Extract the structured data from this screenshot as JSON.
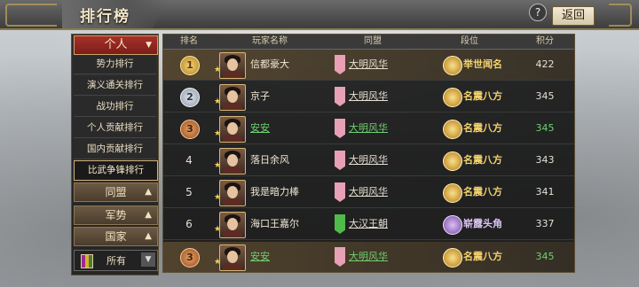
{
  "header": {
    "title": "排行榜",
    "help_icon": "?",
    "back_label": "返回"
  },
  "side": {
    "header": "个人",
    "items": [
      {
        "label": "势力排行",
        "active": false
      },
      {
        "label": "演义通关排行",
        "active": false
      },
      {
        "label": "战功排行",
        "active": false
      },
      {
        "label": "个人贡献排行",
        "active": false
      },
      {
        "label": "国内贡献排行",
        "active": false
      },
      {
        "label": "比武争锋排行",
        "active": true
      }
    ],
    "categories": [
      "同盟",
      "军势",
      "国家"
    ],
    "filter_value": "所有"
  },
  "table": {
    "columns": [
      "排名",
      "玩家名称",
      "同盟",
      "段位",
      "积分"
    ],
    "rows": [
      {
        "rank": "1",
        "medal": "gold",
        "name": "信都豪大",
        "alliance": "大明风华",
        "tier": "举世闻名",
        "score": "422",
        "highlight": true,
        "self": false,
        "tier_style": "gold",
        "banner": "pink"
      },
      {
        "rank": "2",
        "medal": "silver",
        "name": "京子",
        "alliance": "大明风华",
        "tier": "名震八方",
        "score": "345",
        "highlight": false,
        "self": false,
        "tier_style": "gold",
        "banner": "pink"
      },
      {
        "rank": "3",
        "medal": "bronze",
        "name": "安安",
        "alliance": "大明风华",
        "tier": "名震八方",
        "score": "345",
        "highlight": false,
        "self": true,
        "tier_style": "gold",
        "banner": "pink"
      },
      {
        "rank": "4",
        "medal": "",
        "name": "落日余风",
        "alliance": "大明风华",
        "tier": "名震八方",
        "score": "343",
        "highlight": false,
        "self": false,
        "tier_style": "gold",
        "banner": "pink"
      },
      {
        "rank": "5",
        "medal": "",
        "name": "我是暗力棒",
        "alliance": "大明风华",
        "tier": "名震八方",
        "score": "341",
        "highlight": false,
        "self": false,
        "tier_style": "gold",
        "banner": "pink"
      },
      {
        "rank": "6",
        "medal": "",
        "name": "海口王嘉尔",
        "alliance": "大汉王朝",
        "tier": "崭露头角",
        "score": "337",
        "highlight": false,
        "self": false,
        "tier_style": "purple",
        "banner": "green"
      }
    ],
    "self_row": {
      "rank": "3",
      "medal": "bronze",
      "name": "安安",
      "alliance": "大明风华",
      "tier": "名震八方",
      "score": "345"
    }
  }
}
